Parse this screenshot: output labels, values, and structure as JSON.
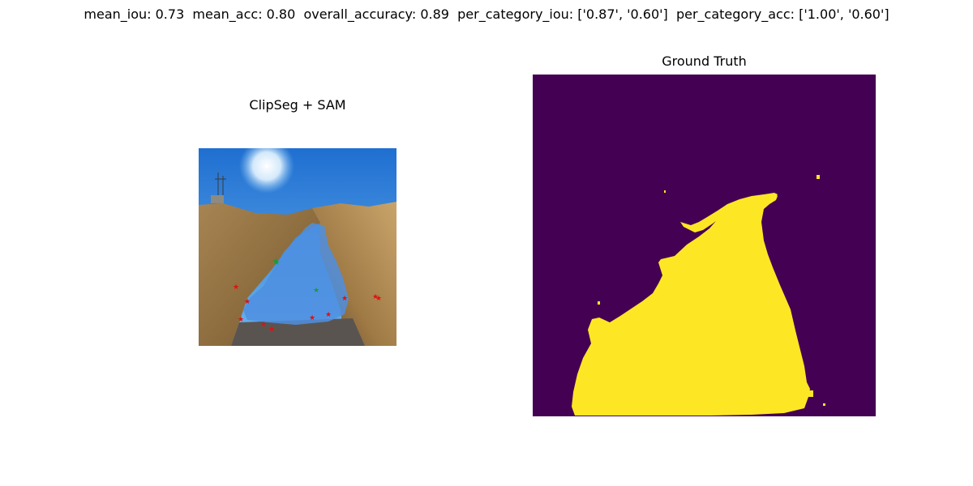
{
  "figure": {
    "suptitle": "mean_iou: 0.73  mean_acc: 0.80  overall_accuracy: 0.89  per_category_iou: ['0.87', '0.60']  per_category_acc: ['1.00', '0.60']"
  },
  "panels": {
    "left": {
      "title": "ClipSeg + SAM"
    },
    "right": {
      "title": "Ground Truth"
    }
  },
  "colors": {
    "mask_fill": "#4f8fe0",
    "positive_point": "#1a9a3a",
    "negative_point": "#e01010",
    "gt_background": "#440154",
    "gt_foreground": "#fde725"
  }
}
